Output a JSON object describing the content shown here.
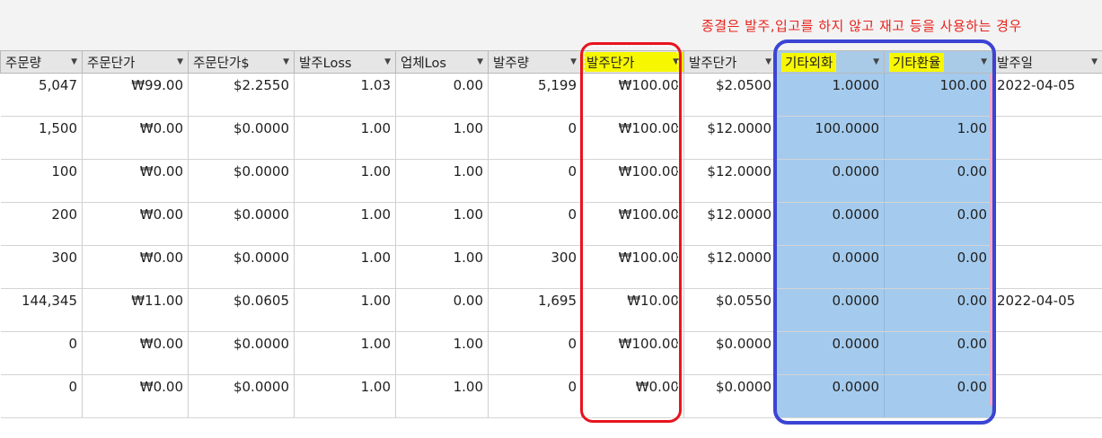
{
  "note": "종결은 발주,입고를 하지 않고 재고 등을 사용하는 경우",
  "columns": [
    "주문량",
    "주문단가",
    "주문단가$",
    "발주Loss",
    "업체Los",
    "발주량",
    "발주단가",
    "발주단가",
    "기타외화",
    "기타환율",
    "발주일"
  ],
  "rows": [
    [
      "5,047",
      "₩99.00",
      "$2.2550",
      "1.03",
      "0.00",
      "5,199",
      "₩100.00",
      "$2.0500",
      "1.0000",
      "100.00",
      "2022-04-05"
    ],
    [
      "1,500",
      "₩0.00",
      "$0.0000",
      "1.00",
      "1.00",
      "0",
      "₩100.00",
      "$12.0000",
      "100.0000",
      "1.00",
      ""
    ],
    [
      "100",
      "₩0.00",
      "$0.0000",
      "1.00",
      "1.00",
      "0",
      "₩100.00",
      "$12.0000",
      "0.0000",
      "0.00",
      ""
    ],
    [
      "200",
      "₩0.00",
      "$0.0000",
      "1.00",
      "1.00",
      "0",
      "₩100.00",
      "$12.0000",
      "0.0000",
      "0.00",
      ""
    ],
    [
      "300",
      "₩0.00",
      "$0.0000",
      "1.00",
      "1.00",
      "300",
      "₩100.00",
      "$12.0000",
      "0.0000",
      "0.00",
      ""
    ],
    [
      "144,345",
      "₩11.00",
      "$0.0605",
      "1.00",
      "0.00",
      "1,695",
      "₩10.00",
      "$0.0550",
      "0.0000",
      "0.00",
      "2022-04-05"
    ],
    [
      "0",
      "₩0.00",
      "$0.0000",
      "1.00",
      "1.00",
      "0",
      "₩100.00",
      "$0.0000",
      "0.0000",
      "0.00",
      ""
    ],
    [
      "0",
      "₩0.00",
      "$0.0000",
      "1.00",
      "1.00",
      "0",
      "₩0.00",
      "$0.0000",
      "0.0000",
      "0.00",
      ""
    ]
  ],
  "colors": {
    "note_text": "#e8231d",
    "highlight_yellow": "#f7f700",
    "selection_blue": "#a4cbee",
    "outline_red": "#e8141f",
    "outline_blue": "#3b44d3"
  }
}
